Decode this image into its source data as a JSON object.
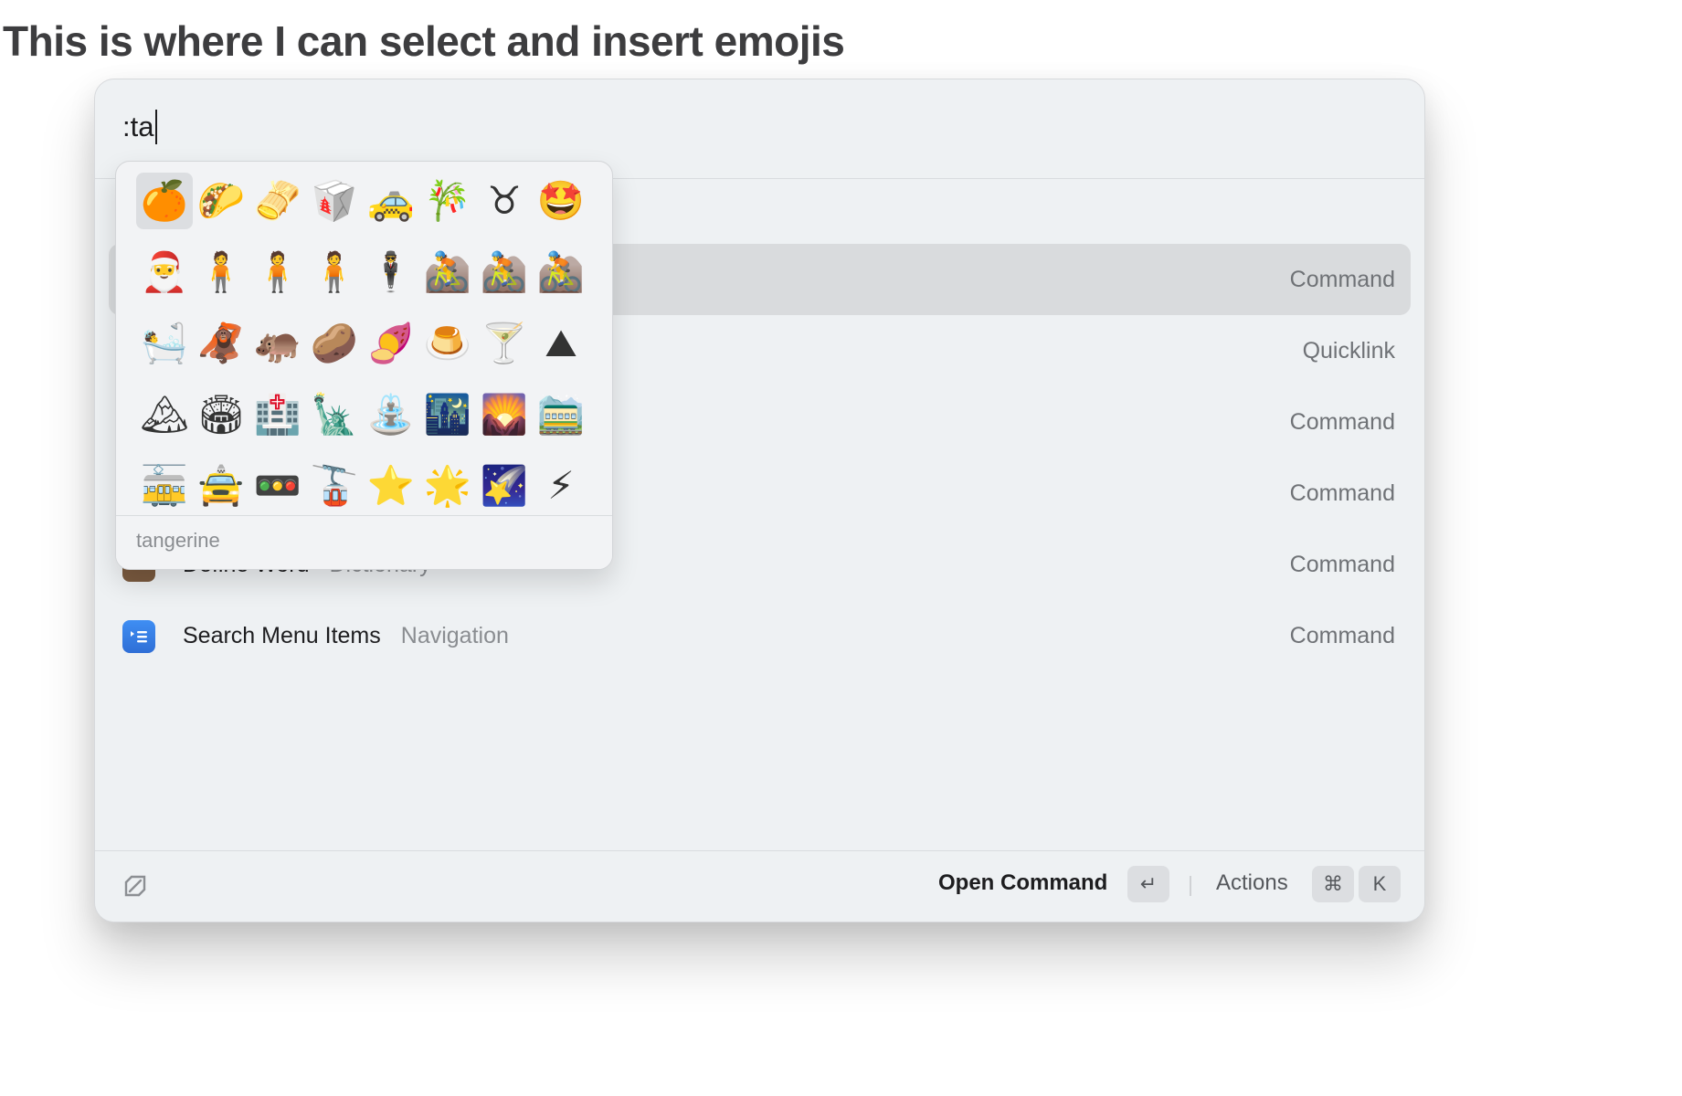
{
  "headline": "This is where I can select and insert emojis",
  "search": {
    "value": ":ta"
  },
  "rows": [
    {
      "title": "",
      "subtitle": "",
      "kind": "Command",
      "selected": true
    },
    {
      "title": "",
      "subtitle": "",
      "kind": "Quicklink"
    },
    {
      "title": "",
      "subtitle": "",
      "kind": "Command"
    },
    {
      "title": "",
      "subtitle": "",
      "kind": "Command"
    },
    {
      "title": "Define Word",
      "subtitle": "Dictionary",
      "kind": "Command"
    },
    {
      "title": "Search Menu Items",
      "subtitle": "Navigation",
      "kind": "Command"
    }
  ],
  "emoji_picker": {
    "emojis": [
      "🍊",
      "🌮",
      "🫔",
      "🥡",
      "🚕",
      "🎋",
      "♉",
      "🤩",
      "🎅",
      "🧍",
      "🧍",
      "🧍",
      "🕴",
      "🚵",
      "🚵",
      "🚵",
      "🛀",
      "🦧",
      "🦛",
      "🥔",
      "🍠",
      "🍮",
      "🍸",
      "⛰",
      "🏔",
      "🏟",
      "🏥",
      "🗽",
      "⛲",
      "🌃",
      "🌄",
      "🚞",
      "🚋",
      "🚖",
      "🚥",
      "🚡",
      "⭐",
      "🌟",
      "🌠",
      "⚡"
    ],
    "selected_index": 0,
    "selected_name": "tangerine"
  },
  "footer": {
    "primary_action": "Open Command",
    "primary_key": "↵",
    "secondary_action": "Actions",
    "secondary_keys": [
      "⌘",
      "K"
    ]
  },
  "icons": {
    "footer_logo": "raycast-logo-icon",
    "menu_items": "menu-list-icon",
    "dictionary": "dictionary-icon"
  }
}
